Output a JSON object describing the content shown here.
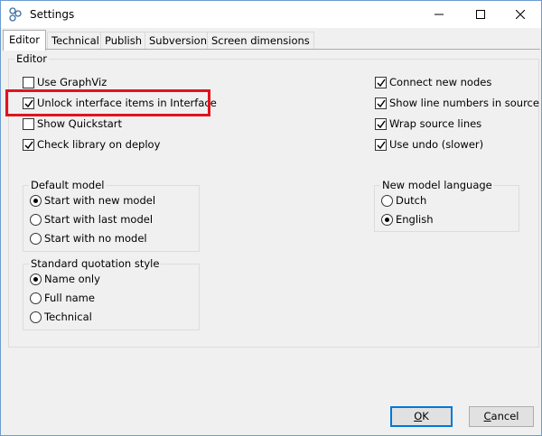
{
  "window": {
    "title": "Settings"
  },
  "tabs": [
    {
      "label": "Editor",
      "active": true
    },
    {
      "label": "Technical",
      "active": false
    },
    {
      "label": "Publish",
      "active": false
    },
    {
      "label": "Subversion",
      "active": false
    },
    {
      "label": "Screen dimensions",
      "active": false
    }
  ],
  "editor": {
    "group_title": "Editor",
    "left_checkboxes": [
      {
        "label": "Use GraphViz",
        "checked": false
      },
      {
        "label": "Unlock interface items in Interface",
        "checked": true
      },
      {
        "label": "Show Quickstart",
        "checked": false
      },
      {
        "label": "Check library on deploy",
        "checked": true
      }
    ],
    "right_checkboxes": [
      {
        "label": "Connect new nodes",
        "checked": true
      },
      {
        "label": "Show line numbers in source",
        "checked": true
      },
      {
        "label": "Wrap source lines",
        "checked": true
      },
      {
        "label": "Use undo (slower)",
        "checked": true
      }
    ],
    "default_model": {
      "title": "Default model",
      "options": [
        {
          "label": "Start with new model",
          "selected": true
        },
        {
          "label": "Start with last model",
          "selected": false
        },
        {
          "label": "Start with no model",
          "selected": false
        }
      ]
    },
    "quotation_style": {
      "title": "Standard quotation style",
      "options": [
        {
          "label": "Name only",
          "selected": true
        },
        {
          "label": "Full name",
          "selected": false
        },
        {
          "label": "Technical",
          "selected": false
        }
      ]
    },
    "model_language": {
      "title": "New model language",
      "options": [
        {
          "label": "Dutch",
          "selected": false
        },
        {
          "label": "English",
          "selected": true
        }
      ]
    }
  },
  "buttons": {
    "ok_mnemonic": "O",
    "ok_rest": "K",
    "cancel_mnemonic": "C",
    "cancel_rest": "ancel"
  },
  "colors": {
    "highlight": "#e0141e",
    "accent": "#0078d7"
  }
}
